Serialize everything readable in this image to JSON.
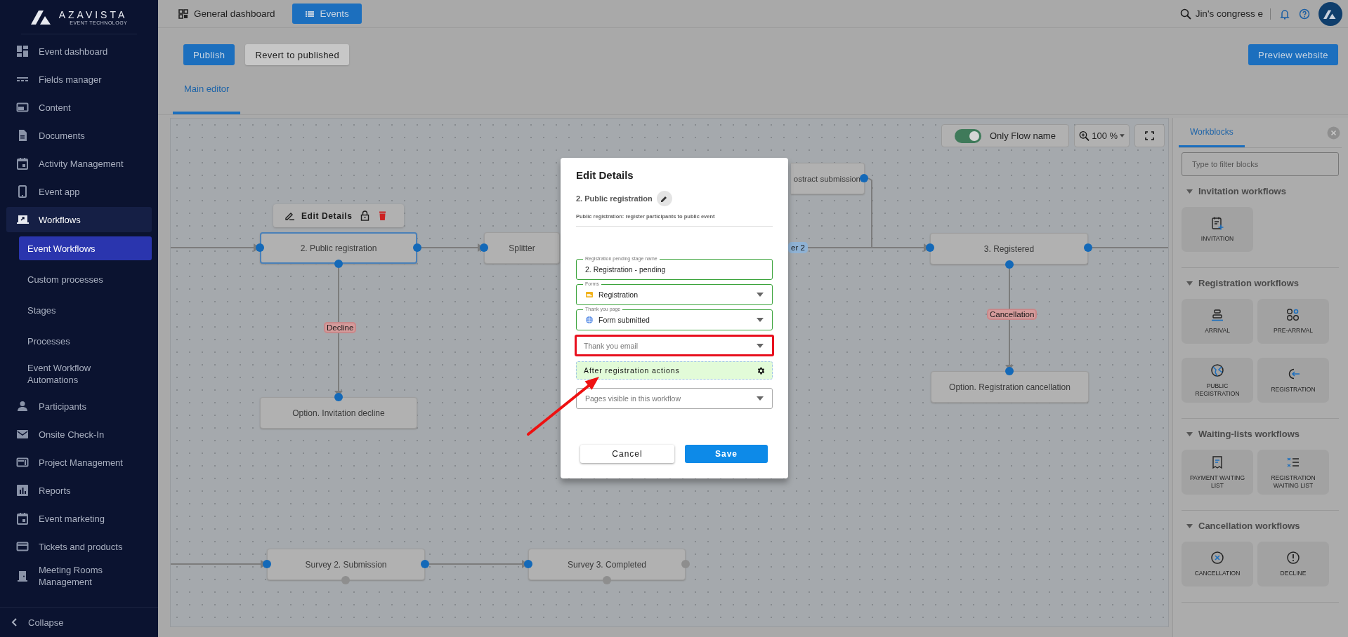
{
  "sidebar": {
    "logo": {
      "name": "AZAVISTA",
      "tagline": "EVENT TECHNOLOGY"
    },
    "items": [
      {
        "label": "Event dashboard",
        "selected": false
      },
      {
        "label": "Fields manager",
        "selected": false
      },
      {
        "label": "Content",
        "selected": false
      },
      {
        "label": "Documents",
        "selected": false
      },
      {
        "label": "Activity Management",
        "selected": false
      },
      {
        "label": "Event app",
        "selected": false
      },
      {
        "label": "Workflows",
        "selected": true,
        "children": [
          {
            "label": "Event Workflows",
            "selected": true
          },
          {
            "label": "Custom processes",
            "selected": false
          },
          {
            "label": "Stages",
            "selected": false
          },
          {
            "label": "Processes",
            "selected": false
          },
          {
            "label": "Event Workflow Automations",
            "selected": false
          }
        ]
      },
      {
        "label": "Participants",
        "selected": false
      },
      {
        "label": "Onsite Check-In",
        "selected": false
      },
      {
        "label": "Project Management",
        "selected": false
      },
      {
        "label": "Reports",
        "selected": false
      },
      {
        "label": "Event marketing",
        "selected": false
      },
      {
        "label": "Tickets and products",
        "selected": false
      },
      {
        "label": "Meeting Rooms Management",
        "selected": false
      }
    ],
    "collapse": "Collapse"
  },
  "topbar": {
    "tabs": [
      {
        "label": "General dashboard",
        "selected": false
      },
      {
        "label": "Events",
        "selected": true
      }
    ],
    "event_search": "Jin's congress e"
  },
  "actions": {
    "publish": "Publish",
    "revert": "Revert to published",
    "preview": "Preview website"
  },
  "editor_tabs": [
    {
      "label": "Main editor",
      "selected": true
    }
  ],
  "canvas": {
    "only_flow_name": {
      "label": "Only Flow name",
      "on": true
    },
    "zoom": "100 %",
    "nodes": [
      {
        "label": "2. Public registration",
        "selected": true
      },
      {
        "label": "Splitter",
        "selected": false
      },
      {
        "label": "ostract submission",
        "selected": false
      },
      {
        "label": "3. Registered",
        "selected": false
      },
      {
        "label": "Option. Registration cancellation",
        "selected": false
      },
      {
        "label": "Option. Invitation decline",
        "selected": false
      },
      {
        "label": "Survey 2. Submission",
        "selected": false
      },
      {
        "label": "Survey 3. Completed",
        "selected": false
      }
    ],
    "edge_labels": [
      {
        "label": "Decline",
        "color": "#d49b9b"
      },
      {
        "label": "Cancellation",
        "color": "#d49b9b"
      },
      {
        "label": "er 2",
        "color": "#8fb2d4"
      }
    ],
    "node_toolbar": {
      "label": "Edit Details"
    }
  },
  "workblocks": {
    "tab": "Workblocks",
    "filter_placeholder": "Type to filter blocks",
    "sections": [
      {
        "title": "Invitation workflows",
        "blocks": [
          "INVITATION"
        ]
      },
      {
        "title": "Registration workflows",
        "blocks": [
          "ARRIVAL",
          "PRE-ARRIVAL",
          "PUBLIC REGISTRATION",
          "REGISTRATION"
        ]
      },
      {
        "title": "Waiting-lists workflows",
        "blocks": [
          "PAYMENT WAITING LIST",
          "REGISTRATION WAITING LIST"
        ]
      },
      {
        "title": "Cancellation workflows",
        "blocks": [
          "CANCELLATION",
          "DECLINE"
        ]
      }
    ]
  },
  "dialog": {
    "title": "Edit Details",
    "stage": "2. Public registration",
    "description": "Public registration: register participants to public event",
    "fields": [
      {
        "kind": "text",
        "label": "Registration pending stage name",
        "value": "2. Registration - pending",
        "highlighted": false
      },
      {
        "kind": "select",
        "label": "Forms",
        "value": "Registration",
        "highlighted": false
      },
      {
        "kind": "select",
        "label": "Thank you page",
        "value": "Form submitted",
        "highlighted": false
      },
      {
        "kind": "select",
        "placeholder": "Thank you email",
        "highlighted": true
      },
      {
        "kind": "action",
        "label": "After registration actions",
        "highlighted": false
      },
      {
        "kind": "select",
        "placeholder": "Pages visible in this workflow",
        "highlighted": false
      }
    ],
    "buttons": [
      {
        "kind": "secondary",
        "label": "Cancel"
      },
      {
        "kind": "primary",
        "label": "Save"
      }
    ]
  }
}
